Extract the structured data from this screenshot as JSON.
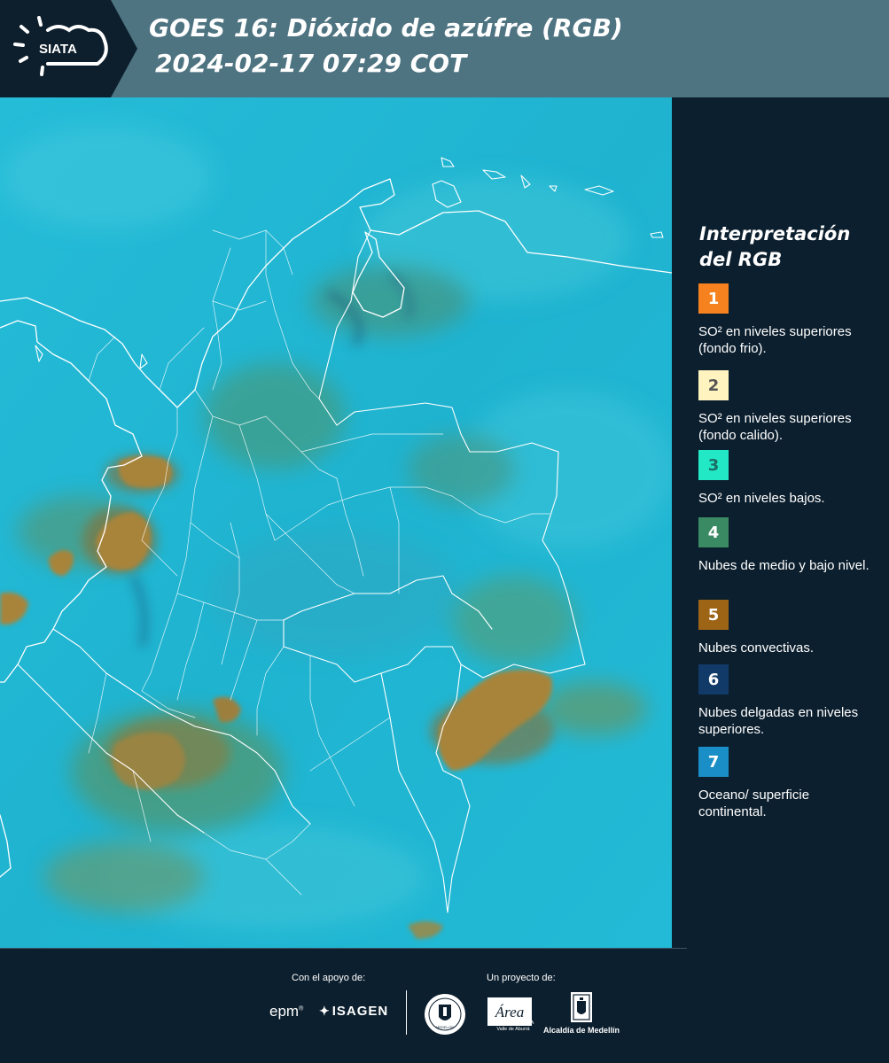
{
  "header": {
    "logo_text": "SIATA",
    "title_line1": "GOES 16: Dióxido de azúfre (RGB)",
    "title_line2": "2024-02-17 07:29 COT"
  },
  "map": {
    "product": "SO2 RGB satellite composite",
    "base_color": "#22b9d6",
    "convective_color": "#a8843a",
    "mid_low_cloud_color": "#4e9a78",
    "border_color": "#ffffff"
  },
  "legend": {
    "title": "Interpretación del RGB",
    "items": [
      {
        "number": "1",
        "color": "#f5821f",
        "number_color": "#ffffff",
        "text": "SO² en niveles superiores (fondo frio)."
      },
      {
        "number": "2",
        "color": "#fff3bf",
        "number_color": "#555555",
        "text": "SO² en niveles superiores (fondo calido)."
      },
      {
        "number": "3",
        "color": "#23e8c6",
        "number_color": "#1a6e66",
        "text": "SO² en niveles bajos."
      },
      {
        "number": "4",
        "color": "#3a8a63",
        "number_color": "#ffffff",
        "text": "Nubes de medio y bajo nivel."
      },
      {
        "number": "5",
        "color": "#9d6416",
        "number_color": "#ffffff",
        "text": "Nubes convectivas."
      },
      {
        "number": "6",
        "color": "#123a68",
        "number_color": "#ffffff",
        "text": "Nubes delgadas en niveles superiores."
      },
      {
        "number": "7",
        "color": "#1a8ec6",
        "number_color": "#ffffff",
        "text": "Oceano/ superficie continental."
      }
    ]
  },
  "footer": {
    "support_caption": "Con el apoyo de:",
    "project_caption": "Un proyecto de:",
    "epm_text": "epm",
    "isagen_text": "ISAGEN",
    "seal_text": "MEDELLÍN",
    "area_title": "Área",
    "area_subtitle": "METROPOLITANA Valle de Aburrá",
    "alcaldia_text": "Alcaldía de Medellín"
  }
}
